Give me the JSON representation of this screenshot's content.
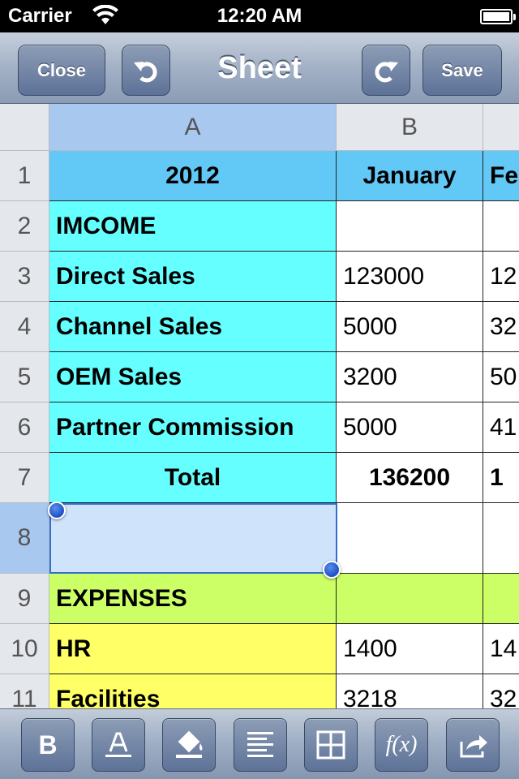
{
  "status_bar": {
    "carrier": "Carrier",
    "time": "12:20 AM"
  },
  "nav": {
    "close_label": "Close",
    "title": "Sheet",
    "save_label": "Save"
  },
  "columns": [
    "A",
    "B"
  ],
  "rows": [
    {
      "num": "1",
      "a": "2012",
      "b": "January",
      "c": "Fe"
    },
    {
      "num": "2",
      "a": "IMCOME",
      "b": "",
      "c": ""
    },
    {
      "num": "3",
      "a": "Direct Sales",
      "b": "123000",
      "c": "12"
    },
    {
      "num": "4",
      "a": "Channel Sales",
      "b": "5000",
      "c": "32"
    },
    {
      "num": "5",
      "a": "OEM Sales",
      "b": "3200",
      "c": "50"
    },
    {
      "num": "6",
      "a": "Partner Commission",
      "b": "5000",
      "c": "41"
    },
    {
      "num": "7",
      "a": "Total",
      "b": "136200",
      "c": "1"
    },
    {
      "num": "8",
      "a": "",
      "b": "",
      "c": ""
    },
    {
      "num": "9",
      "a": "EXPENSES",
      "b": "",
      "c": ""
    },
    {
      "num": "10",
      "a": "HR",
      "b": "1400",
      "c": "14"
    },
    {
      "num": "11",
      "a": "Facilities",
      "b": "3218",
      "c": "32"
    }
  ],
  "selection": {
    "cell": "A8"
  },
  "colors": {
    "header_cyan": "#62c8f5",
    "income_cyan": "#66ffff",
    "expenses_lime": "#ccff66",
    "expense_yellow": "#ffff66",
    "selection_blue": "#2e6fd1"
  },
  "toolbar": {
    "bold_label": "B",
    "icons": [
      "bold-icon",
      "text-color-icon",
      "fill-color-icon",
      "align-icon",
      "borders-icon",
      "function-icon",
      "share-icon"
    ],
    "function_label": "f(x)"
  }
}
